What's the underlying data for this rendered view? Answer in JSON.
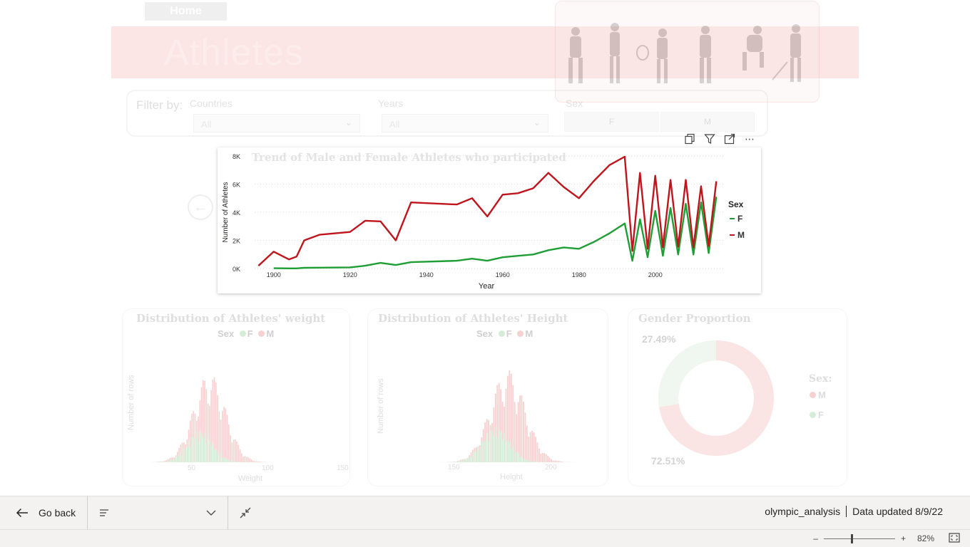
{
  "nav": {
    "home_label": "Home"
  },
  "banner": {
    "title": "Athletes"
  },
  "filters": {
    "label": "Filter by:",
    "countries": {
      "title": "Countries",
      "value": "All"
    },
    "years": {
      "title": "Years",
      "value": "All"
    },
    "sex": {
      "title": "Sex",
      "options": [
        "F",
        "M"
      ]
    }
  },
  "main_chart": {
    "title": "Trend of Male and Female Athletes who participated",
    "legend_title": "Sex",
    "colors": {
      "F": "#1e9e34",
      "M": "#c0151d"
    }
  },
  "weight_card": {
    "title": "Distribution of Athletes' weight",
    "legend_title": "Sex",
    "legend": [
      "F",
      "M"
    ],
    "ylabel": "Number of rows",
    "xlabel": "Weight",
    "ticks": [
      "50",
      "100",
      "150"
    ]
  },
  "height_card": {
    "title": "Distribution of Athletes' Height",
    "legend_title": "Sex",
    "legend": [
      "F",
      "M"
    ],
    "ylabel": "Number of rows",
    "xlabel": "Height",
    "ticks": [
      "150",
      "200"
    ]
  },
  "gender_card": {
    "title": "Gender Proportion",
    "legend_title": "Sex:",
    "legend": [
      "M",
      "F"
    ],
    "f_pct": "27.49%",
    "m_pct": "72.51%",
    "colors": {
      "M": "#f4a0a0",
      "F": "#c9e3cc"
    }
  },
  "footer": {
    "go_back": "Go back",
    "report_name": "olympic_analysis",
    "updated": "Data updated 8/9/22",
    "zoom": "82%"
  },
  "chart_data": {
    "type": "line",
    "title": "Trend of Male and Female Athletes who participated",
    "xlabel": "Year",
    "ylabel": "Number of Athletes",
    "xlim": [
      1895,
      2018
    ],
    "ylim": [
      0,
      8000
    ],
    "x_ticks": [
      "1900",
      "1920",
      "1940",
      "1960",
      "1980",
      "2000"
    ],
    "y_ticks": [
      "0K",
      "2K",
      "4K",
      "6K",
      "8K"
    ],
    "legend_title": "Sex",
    "legend_position": "right",
    "series": [
      {
        "name": "F",
        "points": [
          [
            1900,
            20
          ],
          [
            1904,
            10
          ],
          [
            1906,
            10
          ],
          [
            1908,
            50
          ],
          [
            1912,
            60
          ],
          [
            1920,
            80
          ],
          [
            1924,
            200
          ],
          [
            1928,
            400
          ],
          [
            1932,
            250
          ],
          [
            1936,
            450
          ],
          [
            1948,
            550
          ],
          [
            1952,
            700
          ],
          [
            1956,
            550
          ],
          [
            1960,
            800
          ],
          [
            1964,
            900
          ],
          [
            1968,
            1000
          ],
          [
            1972,
            1300
          ],
          [
            1976,
            1500
          ],
          [
            1980,
            1400
          ],
          [
            1984,
            1900
          ],
          [
            1988,
            2500
          ],
          [
            1992,
            3200
          ],
          [
            1994,
            550
          ],
          [
            1996,
            3500
          ],
          [
            1998,
            800
          ],
          [
            2000,
            4100
          ],
          [
            2002,
            900
          ],
          [
            2004,
            4300
          ],
          [
            2006,
            1000
          ],
          [
            2008,
            4600
          ],
          [
            2010,
            1000
          ],
          [
            2012,
            4700
          ],
          [
            2014,
            1100
          ],
          [
            2016,
            5100
          ]
        ]
      },
      {
        "name": "M",
        "points": [
          [
            1896,
            200
          ],
          [
            1900,
            1200
          ],
          [
            1904,
            650
          ],
          [
            1906,
            850
          ],
          [
            1908,
            2000
          ],
          [
            1912,
            2400
          ],
          [
            1920,
            2600
          ],
          [
            1924,
            3400
          ],
          [
            1928,
            3350
          ],
          [
            1932,
            2000
          ],
          [
            1936,
            4700
          ],
          [
            1948,
            4550
          ],
          [
            1952,
            5000
          ],
          [
            1956,
            3700
          ],
          [
            1960,
            5250
          ],
          [
            1964,
            5350
          ],
          [
            1968,
            5700
          ],
          [
            1972,
            6800
          ],
          [
            1976,
            5800
          ],
          [
            1980,
            5000
          ],
          [
            1984,
            6250
          ],
          [
            1988,
            7350
          ],
          [
            1992,
            7950
          ],
          [
            1994,
            1250
          ],
          [
            1996,
            6800
          ],
          [
            1998,
            1400
          ],
          [
            2000,
            6600
          ],
          [
            2002,
            1500
          ],
          [
            2004,
            6300
          ],
          [
            2006,
            1550
          ],
          [
            2008,
            6300
          ],
          [
            2010,
            1500
          ],
          [
            2012,
            5850
          ],
          [
            2014,
            1600
          ],
          [
            2016,
            6200
          ]
        ]
      }
    ]
  }
}
